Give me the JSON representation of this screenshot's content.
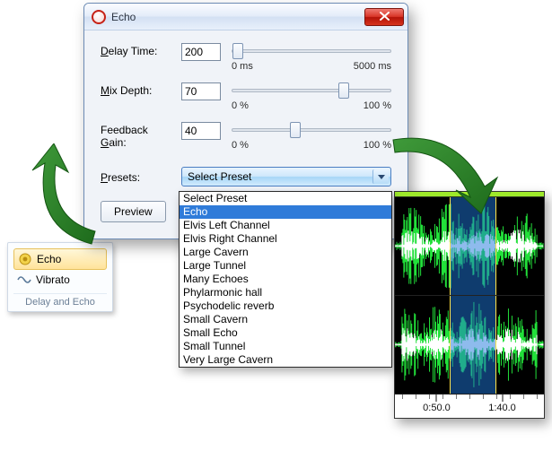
{
  "ribbon": {
    "items": [
      {
        "label": "Echo",
        "selected": true
      },
      {
        "label": "Vibrato",
        "selected": false
      }
    ],
    "caption": "Delay and Echo"
  },
  "dialog": {
    "title": "Echo",
    "params": [
      {
        "key": "delay_time",
        "label_prefix": "",
        "label_ul": "D",
        "label_suffix": "elay Time:",
        "value": "200",
        "min_label": "0 ms",
        "max_label": "5000 ms",
        "min": 0,
        "max": 5000,
        "thumb_pct": 4
      },
      {
        "key": "mix_depth",
        "label_prefix": "",
        "label_ul": "M",
        "label_suffix": "ix Depth:",
        "value": "70",
        "min_label": "0 %",
        "max_label": "100 %",
        "min": 0,
        "max": 100,
        "thumb_pct": 70
      },
      {
        "key": "feedback_gain",
        "label_prefix": "Feedback ",
        "label_ul": "G",
        "label_suffix": "ain:",
        "value": "40",
        "min_label": "0 %",
        "max_label": "100 %",
        "min": 0,
        "max": 100,
        "thumb_pct": 40
      }
    ],
    "presets_label": "Presets:",
    "combo_selected": "Select Preset",
    "preview_label": "Preview"
  },
  "presets": {
    "options": [
      "Select Preset",
      "Echo",
      "Elvis Left Channel",
      "Elvis Right Channel",
      "Large Cavern",
      "Large Tunnel",
      "Many Echoes",
      "Phylarmonic hall",
      "Psychodelic reverb",
      "Small Cavern",
      "Small Echo",
      "Small Tunnel",
      "Very Large Cavern"
    ],
    "highlighted_index": 1
  },
  "waveform": {
    "selection_start_pct": 37,
    "selection_end_pct": 68,
    "ticks": [
      {
        "label": "0:50.0",
        "pct": 28
      },
      {
        "label": "1:40.0",
        "pct": 72
      }
    ]
  }
}
